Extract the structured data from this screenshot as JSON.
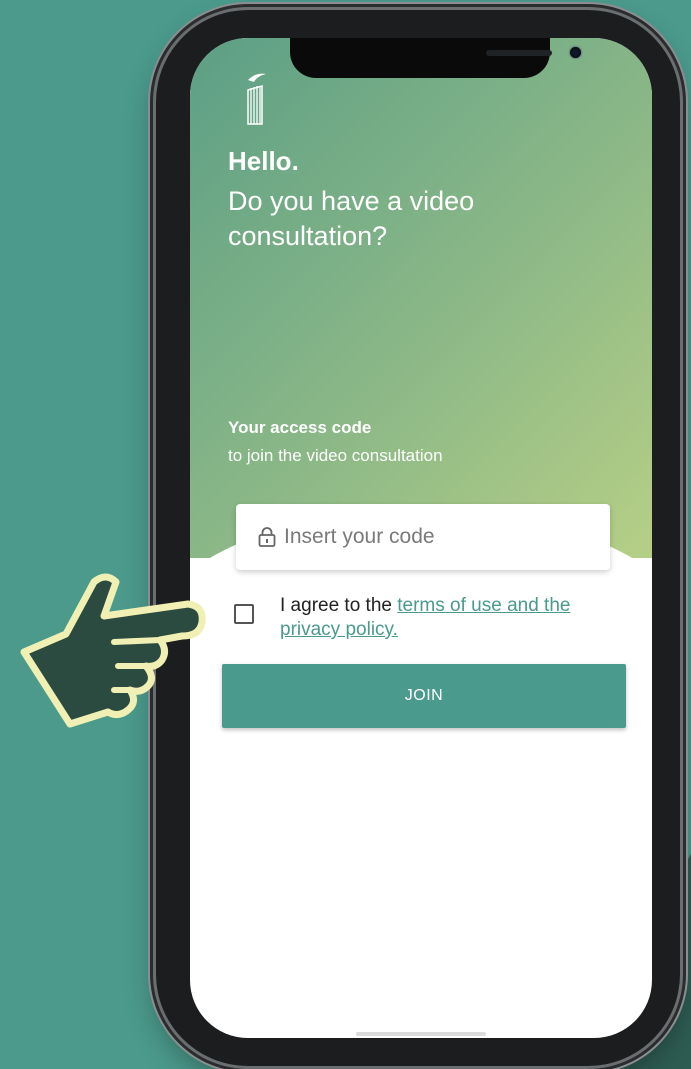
{
  "header": {
    "greeting": "Hello.",
    "question": "Do you have a video consultation?"
  },
  "access": {
    "title": "Your access code",
    "subtitle": "to join the video consultation",
    "placeholder": "Insert your code",
    "value": ""
  },
  "consent": {
    "prefix": "I agree to the ",
    "link": "terms of use and the privacy policy.",
    "checked": false
  },
  "actions": {
    "join_label": "JOIN"
  },
  "icons": {
    "logo": "brand-logo-icon",
    "lock": "lock-icon",
    "pointer": "pointing-hand-icon"
  },
  "colors": {
    "background": "#4b9a8c",
    "accent": "#4a9a8d",
    "hero_start": "#5c9f86",
    "hero_end": "#b6cf86",
    "hand_fill": "#2b4a40",
    "hand_outline": "#f1f0b4"
  }
}
